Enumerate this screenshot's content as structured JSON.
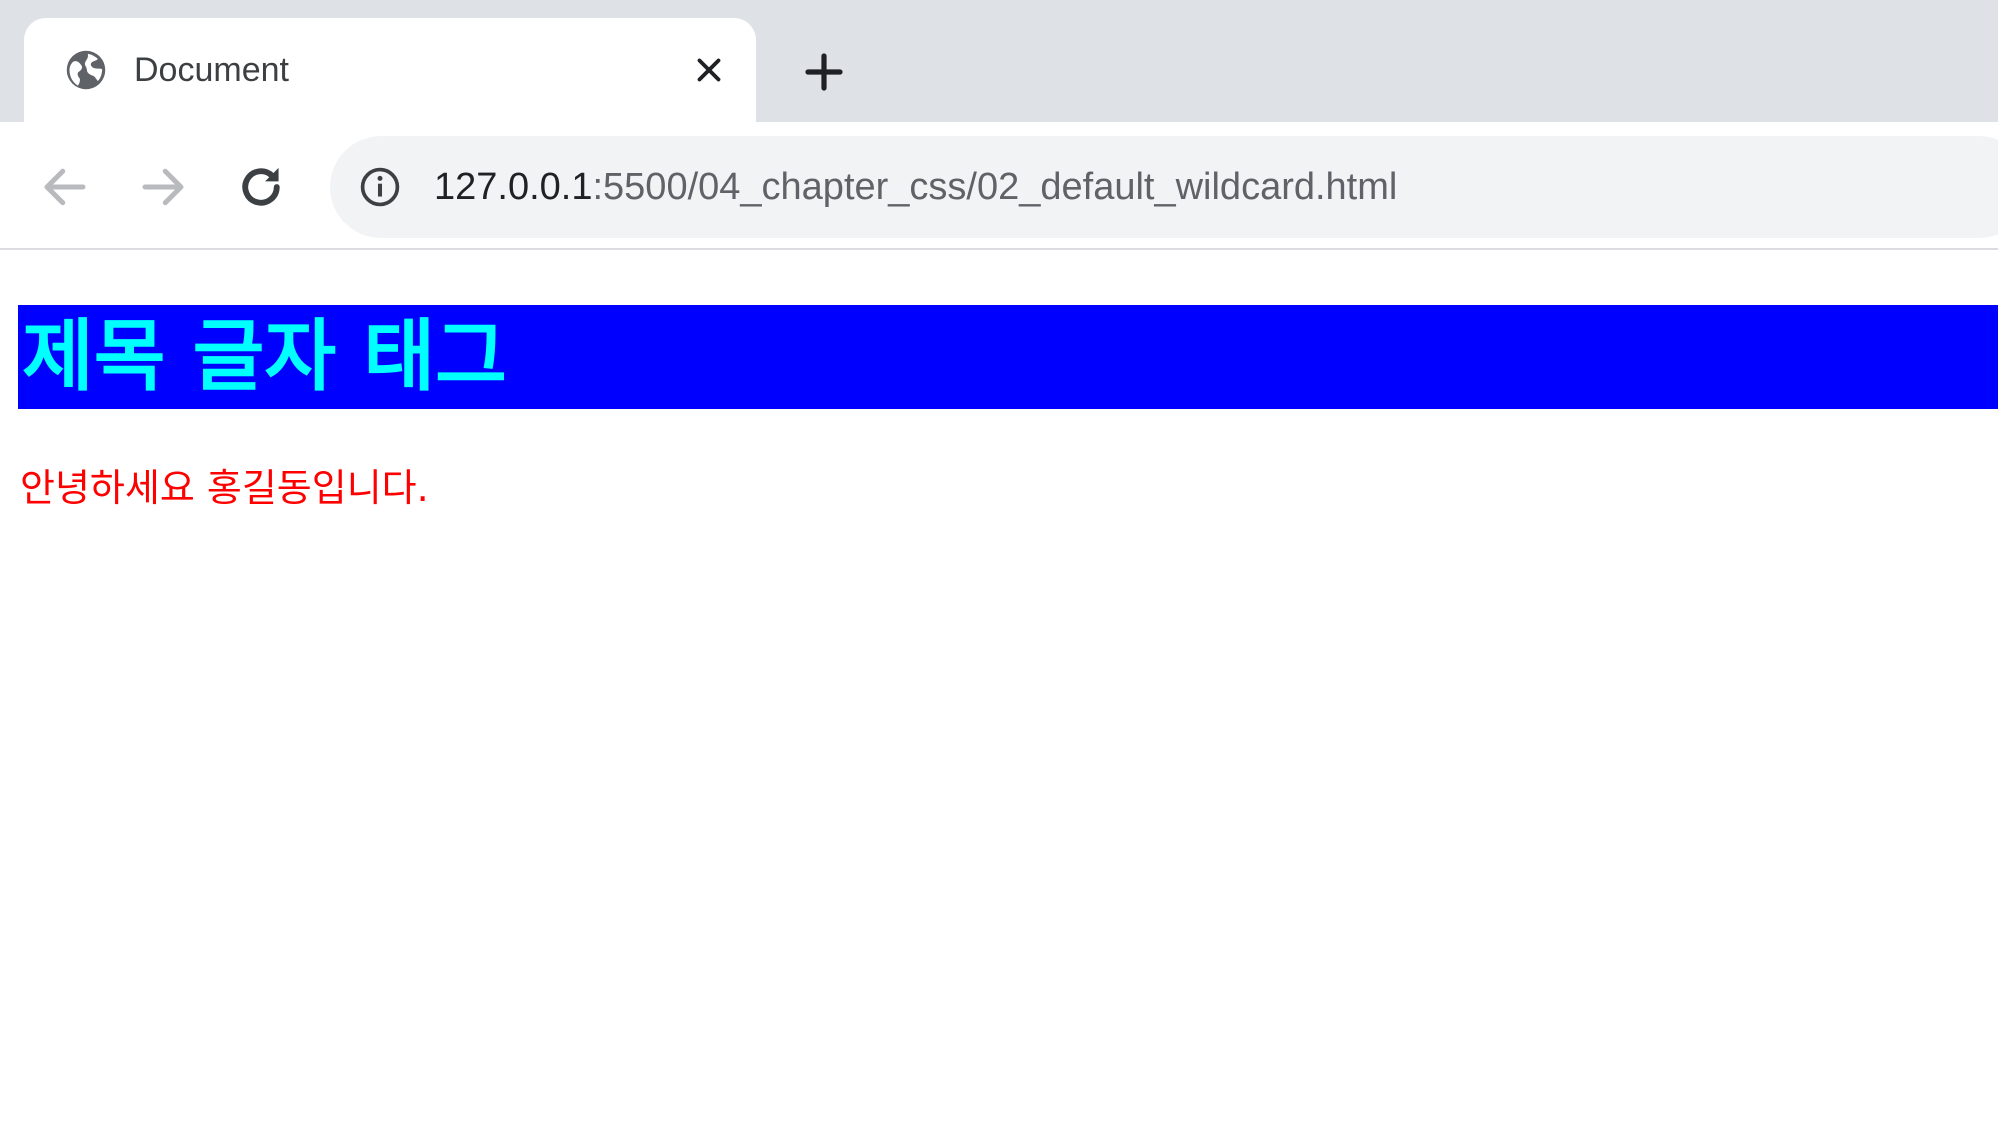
{
  "browser": {
    "tab": {
      "title": "Document",
      "icon": "globe-icon",
      "close_icon": "close-icon"
    },
    "new_tab_icon": "plus-icon",
    "toolbar": {
      "back_icon": "arrow-left-icon",
      "forward_icon": "arrow-right-icon",
      "reload_icon": "reload-icon",
      "info_icon": "info-icon"
    },
    "address": {
      "host": "127.0.0.1",
      "path": ":5500/04_chapter_css/02_default_wildcard.html"
    }
  },
  "page": {
    "heading": "제목 글자 태그",
    "paragraph": "안녕하세요 홍길동입니다."
  },
  "colors": {
    "heading_background": "#0000ff",
    "heading_text": "#00ffff",
    "paragraph_text": "#ff0000",
    "tabstrip": "#dee1e6",
    "omnibox": "#f1f3f4"
  }
}
